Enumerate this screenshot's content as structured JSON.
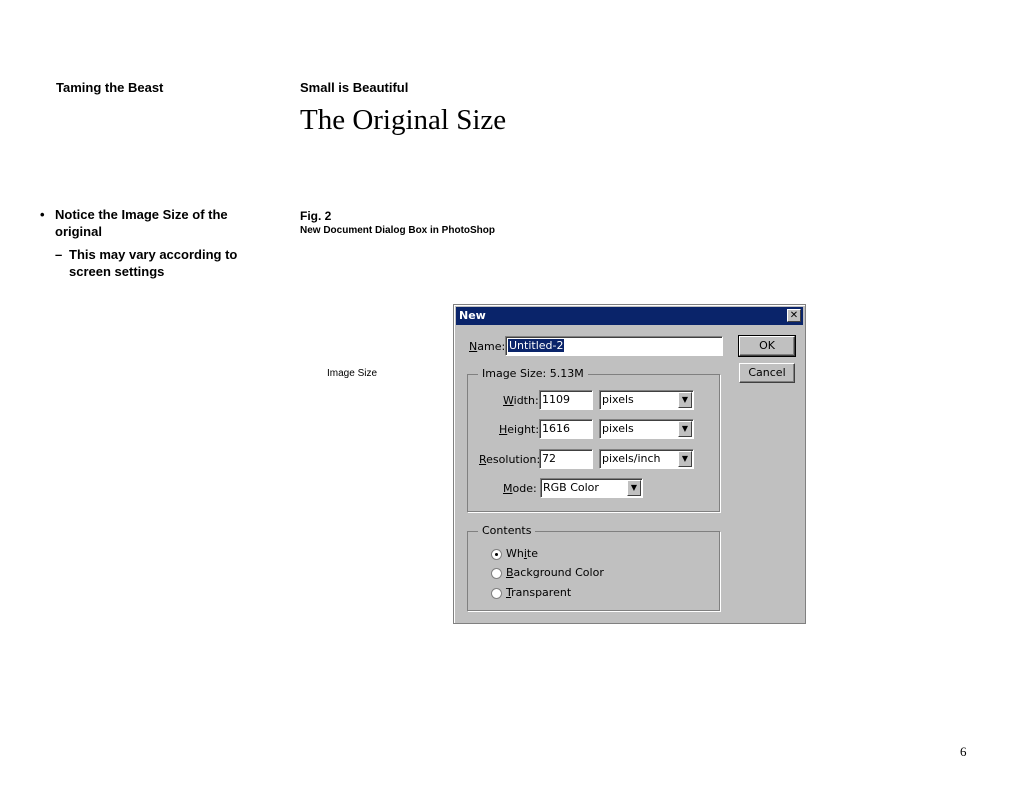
{
  "slide": {
    "left_header": "Taming the Beast",
    "right_header": "Small is Beautiful",
    "title": "The Original Size",
    "bullets": [
      {
        "marker": "•",
        "text_line1": "Notice the Image Size of the",
        "text_line2": "original"
      },
      {
        "marker": "–",
        "text_line1": "This may vary according to",
        "text_line2": "screen settings"
      }
    ],
    "fig_label": "Fig. 2",
    "fig_caption": "New Document Dialog Box in PhotoShop",
    "side_label": "Image Size",
    "page_number": "6"
  },
  "dialog": {
    "title": "New",
    "close_glyph": "✕",
    "name_label_u": "N",
    "name_label_rest": "ame:",
    "name_value": "Untitled-2",
    "ok_label": "OK",
    "cancel_label": "Cancel",
    "image_size_title": "Image Size:  5.13M",
    "width_label_u": "W",
    "width_label_rest": "idth:",
    "width_value": "1109",
    "width_unit": "pixels",
    "height_label_u": "H",
    "height_label_rest": "eight:",
    "height_value": "1616",
    "height_unit": "pixels",
    "resolution_label_u": "R",
    "resolution_label_rest": "esolution:",
    "resolution_value": "72",
    "resolution_unit": "pixels/inch",
    "mode_label_u": "M",
    "mode_label_rest": "ode:",
    "mode_value": "RGB Color",
    "contents_title": "Contents",
    "contents_options": [
      {
        "pre": "Wh",
        "u": "i",
        "post": "te",
        "selected": true
      },
      {
        "pre": "",
        "u": "B",
        "post": "ackground Color",
        "selected": false
      },
      {
        "pre": "",
        "u": "T",
        "post": "ransparent",
        "selected": false
      }
    ],
    "arrow_glyph": "▼"
  }
}
